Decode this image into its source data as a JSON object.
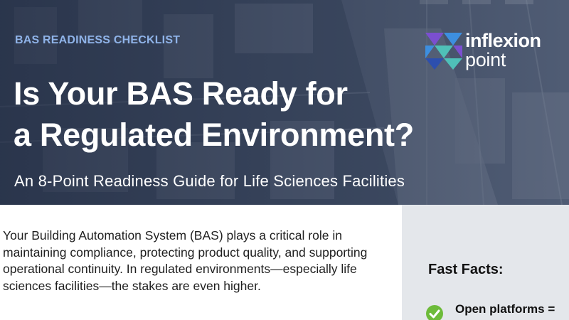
{
  "hero": {
    "eyebrow": "BAS READINESS CHECKLIST",
    "title_line1": "Is Your BAS Ready for",
    "title_line2": "a Regulated Environment?",
    "subtitle": "An 8-Point Readiness Guide for Life Sciences Facilities",
    "background_image": "factory-floor-photo"
  },
  "logo": {
    "word1": "inflexion",
    "word2": "point",
    "colors": [
      "#7b4fd0",
      "#3d8fe0",
      "#4fc0b8",
      "#2d4fae"
    ]
  },
  "intro": {
    "paragraph": "Your Building Automation System (BAS) plays a critical role in maintaining compliance, protecting product quality, and supporting operational continuity. In regulated environments—especially life sciences facilities—the stakes are even higher."
  },
  "fast_facts": {
    "title": "Fast Facts:",
    "items": [
      {
        "icon": "check-circle-icon",
        "text": "Open platforms ="
      }
    ]
  },
  "colors": {
    "eyebrow": "#8fb3e8",
    "check": "#6dbb3a",
    "sidebar_bg": "#e4e7eb"
  }
}
